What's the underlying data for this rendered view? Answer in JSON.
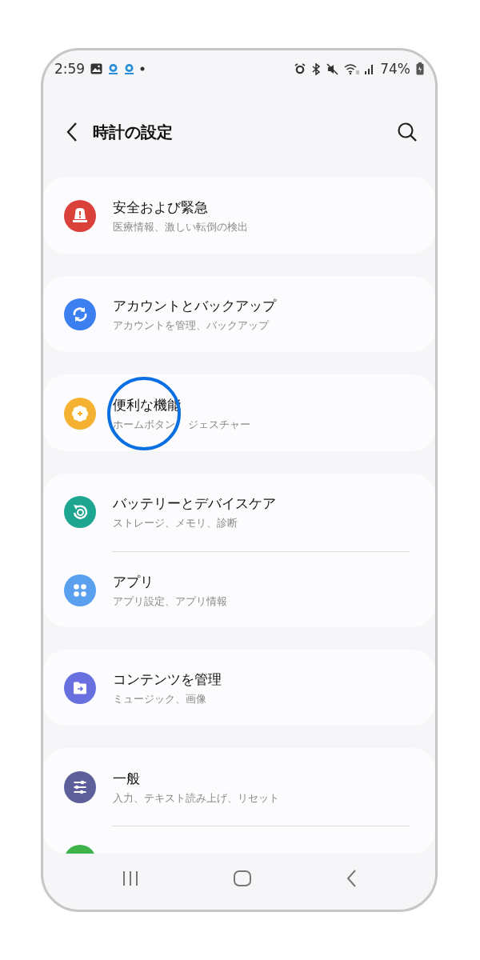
{
  "status_bar": {
    "time": "2:59",
    "battery": "74%"
  },
  "header": {
    "title": "時計の設定"
  },
  "groups": [
    {
      "items": [
        {
          "kind": "row",
          "color": "#d9413a",
          "title": "安全および緊急",
          "subtitle": "医療情報、激しい転倒の検出",
          "highlighted": false
        }
      ]
    },
    {
      "items": [
        {
          "kind": "row",
          "color": "#3c7ff0",
          "title": "アカウントとバックアップ",
          "subtitle": "アカウントを管理、バックアップ",
          "highlighted": false
        }
      ]
    },
    {
      "items": [
        {
          "kind": "row",
          "color": "#f4b132",
          "title": "便利な機能",
          "subtitle": "ホームボタン",
          "subtitle_rest": "ジェスチャー",
          "highlighted": true
        }
      ]
    },
    {
      "items": [
        {
          "kind": "row",
          "color": "#1ea590",
          "title": "バッテリーとデバイスケア",
          "subtitle": "ストレージ、メモリ、診断",
          "highlighted": false
        },
        {
          "kind": "row",
          "color": "#5aa0ee",
          "title": "アプリ",
          "subtitle": "アプリ設定、アプリ情報",
          "highlighted": false
        }
      ]
    },
    {
      "items": [
        {
          "kind": "row",
          "color": "#6a6fe0",
          "title": "コンテンツを管理",
          "subtitle": "ミュージック、画像",
          "highlighted": false
        }
      ]
    },
    {
      "items": [
        {
          "kind": "row",
          "color": "#5d5f9a",
          "title": "一般",
          "subtitle": "入力、テキスト読み上げ、リセット",
          "highlighted": false
        },
        {
          "kind": "cut",
          "color": "#3db34a"
        }
      ]
    }
  ]
}
